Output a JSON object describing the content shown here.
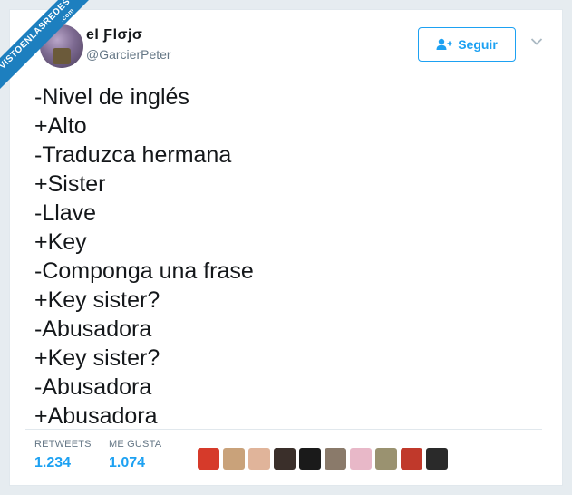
{
  "watermark": {
    "text": "VISTOENLASREDES",
    "suffix": ".com"
  },
  "user": {
    "name": "el Ƒlσjσ",
    "handle": "@GarcierPeter"
  },
  "follow_button": {
    "label": "Seguir"
  },
  "tweet": {
    "lines": [
      "-Nivel de inglés",
      "+Alto",
      "-Traduzca hermana",
      "+Sister",
      "-Llave",
      "+Key",
      "-Componga una frase",
      "+Key sister?",
      "-Abusadora",
      "+Key sister?",
      "-Abusadora",
      "+Abusadora"
    ]
  },
  "stats": {
    "retweets_label": "RETWEETS",
    "retweets_value": "1.234",
    "likes_label": "ME GUSTA",
    "likes_value": "1.074"
  },
  "likers": {
    "count": 10,
    "colors": [
      "#d63a2a",
      "#c9a27a",
      "#e0b49a",
      "#3a2f2a",
      "#1a1a1a",
      "#8a7a6a",
      "#e8b8c8",
      "#9a9270",
      "#c0392b",
      "#2a2a2a"
    ]
  },
  "colors": {
    "accent": "#1da1f2",
    "text": "#14171a",
    "muted": "#657786",
    "background": "#e6ecf0"
  }
}
